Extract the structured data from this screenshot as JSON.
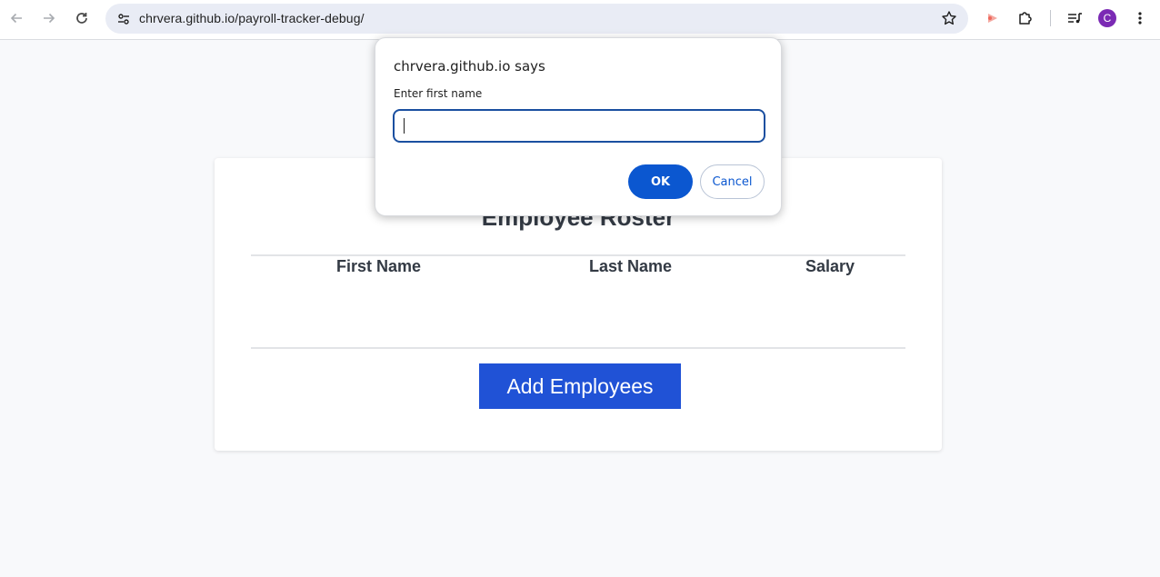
{
  "browser": {
    "url": "chrvera.github.io/payroll-tracker-debug/",
    "avatar_initial": "C",
    "avatar_color": "#7b2ab4",
    "icons": [
      "back-arrow-icon",
      "forward-arrow-icon",
      "reload-icon",
      "site-info-icon",
      "bookmark-star-icon",
      "screen-record-icon",
      "extensions-puzzle-icon",
      "reading-list-icon",
      "kebab-menu-icon"
    ]
  },
  "page": {
    "title": "Employee Roster",
    "columns": [
      "First Name",
      "Last Name",
      "Salary"
    ],
    "add_button_label": "Add Employees",
    "accent_color": "#2052d6"
  },
  "dialog": {
    "title": "chrvera.github.io says",
    "message": "Enter first name",
    "input_value": "",
    "ok_label": "OK",
    "cancel_label": "Cancel",
    "ok_color": "#0b57d0",
    "cancel_text_color": "#0b57d0"
  }
}
